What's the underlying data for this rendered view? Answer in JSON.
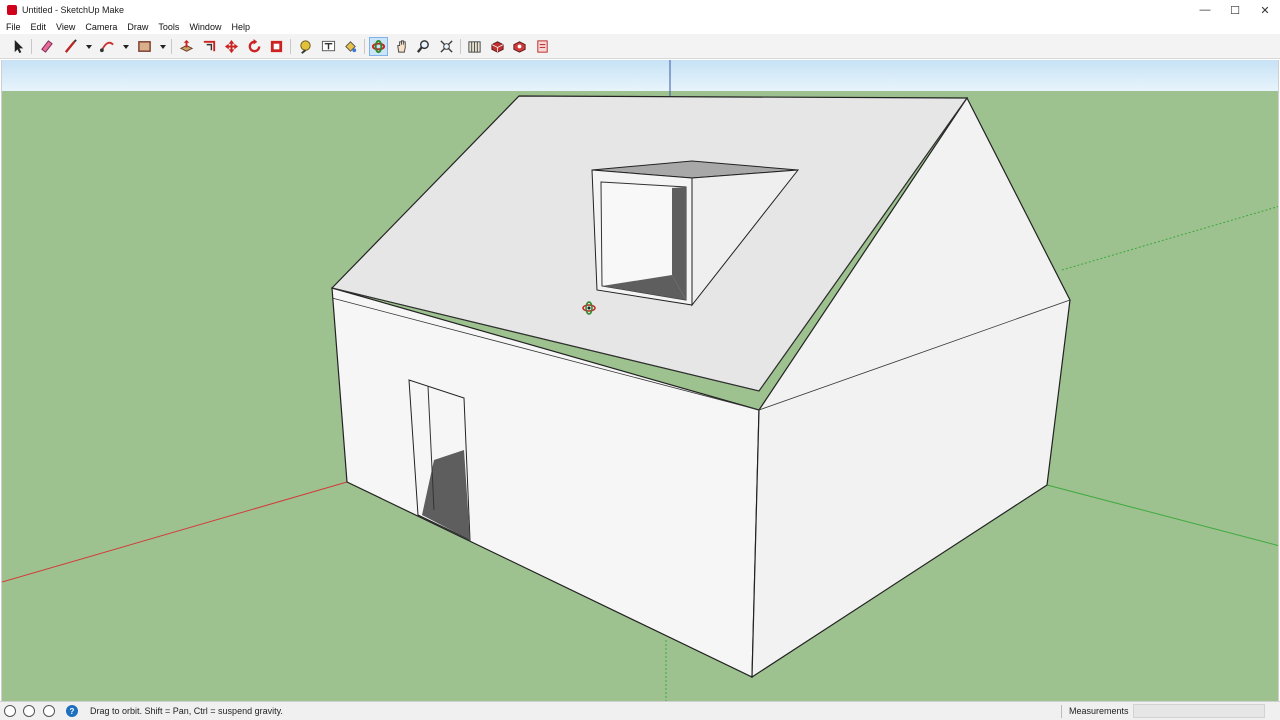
{
  "window": {
    "title": "Untitled - SketchUp Make",
    "minimize_glyph": "—",
    "maximize_glyph": "☐",
    "close_glyph": "✕"
  },
  "menu": {
    "items": [
      "File",
      "Edit",
      "View",
      "Camera",
      "Draw",
      "Tools",
      "Window",
      "Help"
    ]
  },
  "toolbar": {
    "tools": [
      {
        "name": "select-icon"
      },
      {
        "name": "eraser-icon"
      },
      {
        "name": "line-icon"
      },
      {
        "name": "arc-icon"
      },
      {
        "name": "rectangle-icon"
      },
      {
        "name": "push-pull-icon"
      },
      {
        "name": "offset-icon"
      },
      {
        "name": "move-icon"
      },
      {
        "name": "rotate-icon"
      },
      {
        "name": "scale-icon"
      },
      {
        "name": "tape-measure-icon"
      },
      {
        "name": "text-icon"
      },
      {
        "name": "paint-bucket-icon"
      },
      {
        "name": "orbit-icon",
        "active": true
      },
      {
        "name": "pan-icon"
      },
      {
        "name": "zoom-icon"
      },
      {
        "name": "zoom-extents-icon"
      },
      {
        "name": "warehouse-icon"
      },
      {
        "name": "extension-icon"
      },
      {
        "name": "extension-warehouse-icon"
      },
      {
        "name": "layout-icon"
      }
    ]
  },
  "viewport": {
    "sky_color": "#d6ebf7",
    "ground_color": "#9dc28f",
    "wall_color": "#f4f4f4",
    "roof_color": "#e4e4e4",
    "opening_color": "#5e5e5e",
    "red_axis_color": "#d23a3a",
    "green_axis_color": "#3ea83e",
    "cursor_icon": "orbit-cursor-icon"
  },
  "status": {
    "icons": [
      "geo-location-icon",
      "credits-icon",
      "user-icon",
      "help-icon"
    ],
    "help_glyph": "?",
    "text": "Drag to orbit. Shift = Pan, Ctrl = suspend gravity.",
    "measurements_label": "Measurements",
    "measurements_value": ""
  }
}
